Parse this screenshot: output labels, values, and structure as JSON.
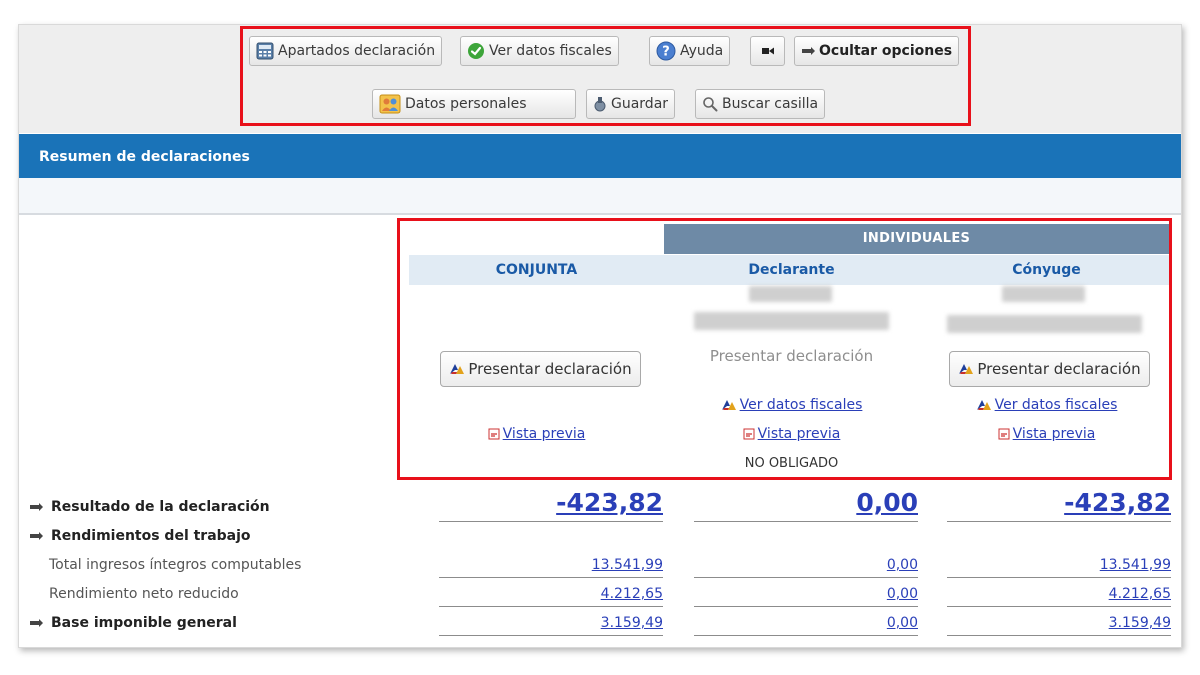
{
  "toolbar": {
    "apartados": "Apartados declaración",
    "ver_datos": "Ver datos fiscales",
    "ayuda": "Ayuda",
    "ocultar": "Ocultar opciones",
    "datos_personales": "Datos personales",
    "guardar": "Guardar",
    "buscar": "Buscar casilla"
  },
  "section_title": "Resumen de declaraciones",
  "group_header": "INDIVIDUALES",
  "columns": [
    {
      "title": "CONJUNTA",
      "action": "Presentar declaración",
      "preview": "Vista previa"
    },
    {
      "title": "Declarante",
      "action": "Presentar declaración",
      "ver_datos": "Ver datos fiscales",
      "preview": "Vista previa",
      "status": "NO OBLIGADO"
    },
    {
      "title": "Cónyuge",
      "action": "Presentar declaración",
      "ver_datos": "Ver datos fiscales",
      "preview": "Vista previa"
    }
  ],
  "rows": [
    {
      "label": "Resultado de la declaración",
      "values": [
        "-423,82",
        "0,00",
        "-423,82"
      ]
    },
    {
      "label": "Rendimientos del trabajo"
    },
    {
      "label": "Total ingresos íntegros computables",
      "values": [
        "13.541,99",
        "0,00",
        "13.541,99"
      ]
    },
    {
      "label": "Rendimiento neto reducido",
      "values": [
        "4.212,65",
        "0,00",
        "4.212,65"
      ]
    },
    {
      "label": "Base imponible general",
      "values": [
        "3.159,49",
        "0,00",
        "3.159,49"
      ]
    }
  ]
}
